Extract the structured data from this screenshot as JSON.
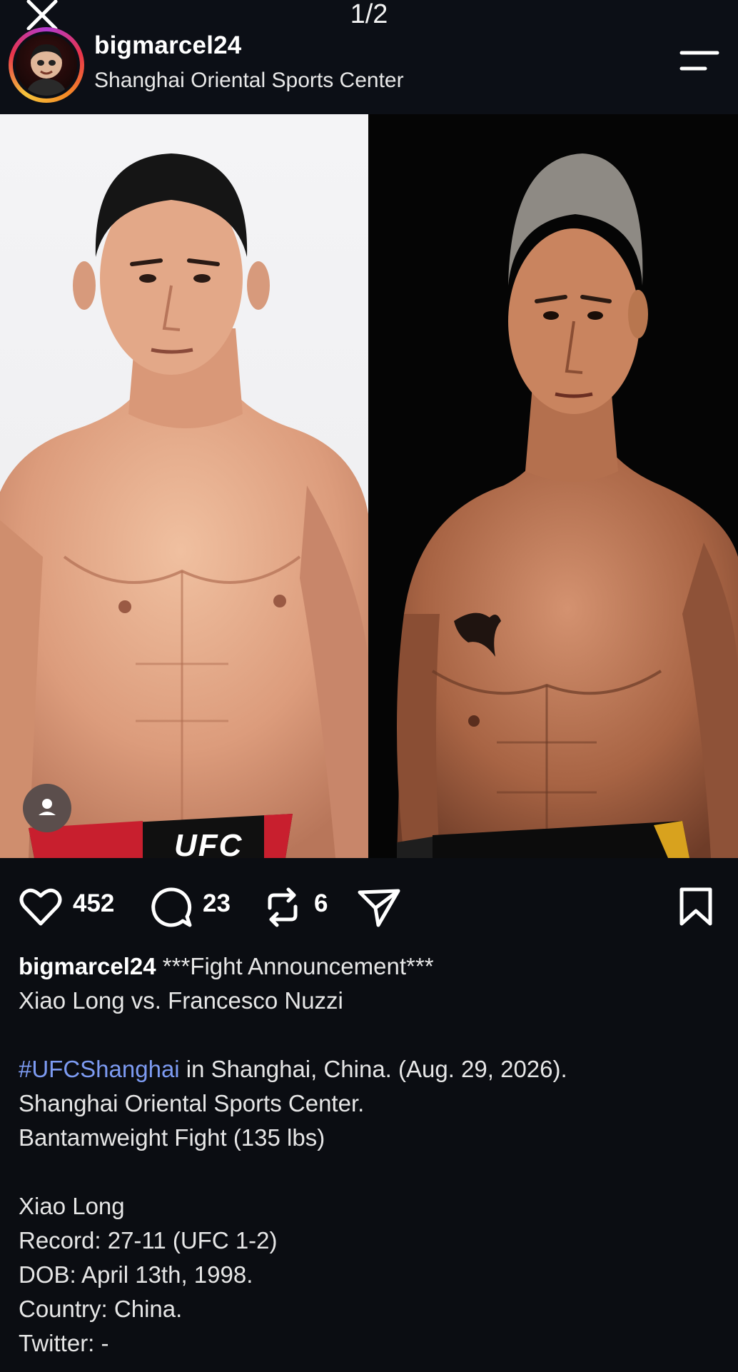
{
  "header": {
    "page_indicator": "1/2",
    "username": "bigmarcel24",
    "location": "Shanghai Oriental Sports Center",
    "close_icon": "close-icon",
    "menu_icon": "menu-icon"
  },
  "photo": {
    "left_shorts_logo": "UFC",
    "left_background": "#efeff1",
    "right_background": "#050505"
  },
  "actions": {
    "likes": "452",
    "comments": "23",
    "reposts": "6"
  },
  "caption": {
    "user": "bigmarcel24",
    "title": "***Fight Announcement***",
    "matchup": "Xiao Long vs. Francesco Nuzzi",
    "hashtag": "#UFCShanghai",
    "location_text": " in Shanghai, China. (Aug. 29, 2026).",
    "venue": "Shanghai Oriental Sports Center.",
    "weight_class": "Bantamweight Fight (135 lbs)",
    "fighter_name": "Xiao Long",
    "record": "Record: 27-11 (UFC 1-2)",
    "dob": "DOB: April 13th, 1998.",
    "country": "Country: China.",
    "twitter": "Twitter: -"
  },
  "colors": {
    "background": "#0b0d12",
    "hashtag": "#7d9bf2",
    "text": "#e6e6e6"
  }
}
